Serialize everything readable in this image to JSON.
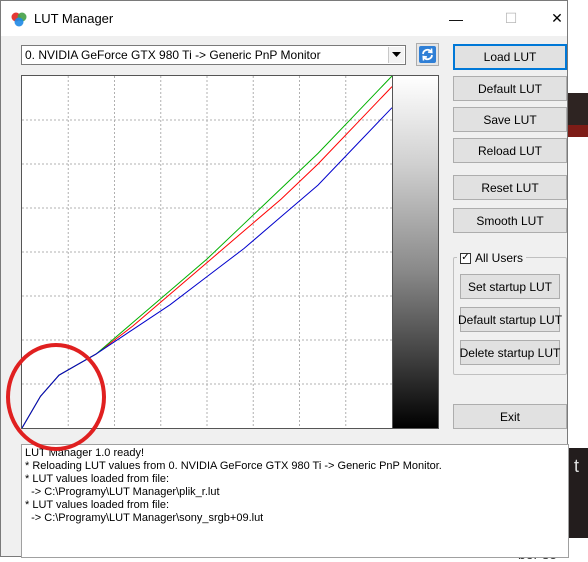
{
  "window": {
    "title": "LUT Manager"
  },
  "device_select": {
    "value": "0. NVIDIA GeForce GTX 980 Ti -> Generic PnP Monitor"
  },
  "buttons": {
    "load": "Load LUT",
    "default": "Default LUT",
    "save": "Save LUT",
    "reload": "Reload LUT",
    "reset": "Reset LUT",
    "smooth": "Smooth LUT",
    "exit": "Exit"
  },
  "startup_group": {
    "all_users_label": "All Users",
    "all_users_checked": true,
    "set": "Set startup LUT",
    "default": "Default startup LUT",
    "delete": "Delete startup LUT"
  },
  "log": {
    "lines": [
      "LUT Manager 1.0 ready!",
      "* Reloading LUT values from 0. NVIDIA GeForce GTX 980 Ti -> Generic PnP Monitor.",
      "* LUT values loaded from file:",
      "  -> C:\\Programy\\LUT Manager\\plik_r.lut",
      "* LUT values loaded from file:",
      "  -> C:\\Programy\\LUT Manager\\sony_srgb+09.lut"
    ]
  },
  "background": {
    "right_glyph": "t",
    "bottom_text": "bor se"
  },
  "chart_data": {
    "type": "line",
    "x": [
      0,
      5,
      10,
      15,
      20,
      30,
      40,
      50,
      60,
      70,
      80,
      90,
      100
    ],
    "series": [
      {
        "color": "#ff0000",
        "values": [
          0,
          9,
          15,
          18,
          21,
          29,
          38,
          47,
          56,
          65,
          75,
          86,
          97
        ]
      },
      {
        "color": "#00b000",
        "values": [
          0,
          9,
          15,
          18,
          21,
          30,
          39,
          48,
          58,
          68,
          78,
          89,
          100
        ]
      },
      {
        "color": "#0000cc",
        "values": [
          0,
          9,
          15,
          18,
          21,
          28,
          35,
          43,
          51,
          60,
          69,
          80,
          91
        ]
      }
    ],
    "xlim": [
      0,
      100
    ],
    "ylim": [
      0,
      100
    ],
    "grid": true,
    "gridlines": 8,
    "xlabel": "",
    "ylabel": ""
  }
}
